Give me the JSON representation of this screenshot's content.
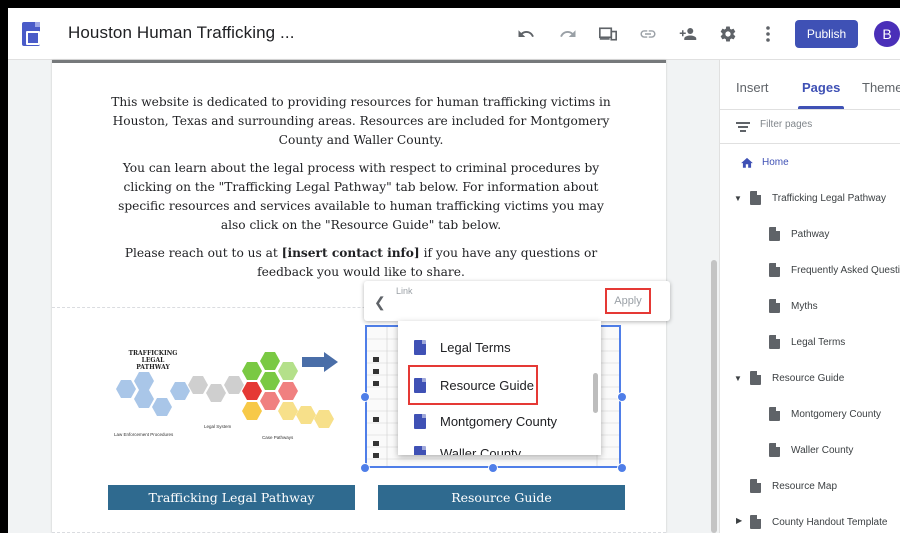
{
  "topbar": {
    "doc_title": "Houston Human Trafficking ...",
    "publish_label": "Publish",
    "avatar_letter": "B",
    "icons": [
      "undo-icon",
      "redo-icon",
      "preview-icon",
      "link-icon",
      "share-icon",
      "settings-icon",
      "more-vert-icon"
    ]
  },
  "intro": {
    "p1": "This website is dedicated to providing resources for human trafficking victims in Houston, Texas and surrounding areas. Resources are included for Montgomery County and Waller County.",
    "p2": "You can learn about the legal process with respect to criminal procedures by clicking on the \"Trafficking Legal Pathway\" tab below. For information about specific resources and services available to human trafficking victims you may also click on the \"Resource Guide\" tab below.",
    "p3_before": "Please reach out to us at ",
    "p3_bold": "[insert contact info]",
    "p3_after": " if you have any questions or feedback you would like to share."
  },
  "diagram": {
    "title": "Trafficking Legal Pathway",
    "caption_left": "Law Enforcement Procedures",
    "caption_mid": "Legal System",
    "caption_right": "Case Pathways"
  },
  "buttons": {
    "legal_pathway": "Trafficking Legal Pathway",
    "resource_guide": "Resource Guide"
  },
  "link_popup": {
    "label": "Link",
    "apply": "Apply",
    "items": [
      "Legal Terms",
      "Resource Guide",
      "Montgomery County",
      "Waller County"
    ]
  },
  "panel": {
    "tabs": [
      "Insert",
      "Pages",
      "Themes"
    ],
    "active_tab": "Pages",
    "filter_placeholder": "Filter pages",
    "pages": [
      {
        "label": "Home",
        "level": 0,
        "home": true
      },
      {
        "label": "Trafficking Legal Pathway",
        "level": 0,
        "expanded": true
      },
      {
        "label": "Pathway",
        "level": 1
      },
      {
        "label": "Frequently Asked Questi...",
        "level": 1
      },
      {
        "label": "Myths",
        "level": 1
      },
      {
        "label": "Legal Terms",
        "level": 1
      },
      {
        "label": "Resource Guide",
        "level": 0,
        "expanded": true
      },
      {
        "label": "Montgomery County",
        "level": 1
      },
      {
        "label": "Waller County",
        "level": 1
      },
      {
        "label": "Resource Map",
        "level": 0
      },
      {
        "label": "County Handout Template",
        "level": 0,
        "collapsed": true
      }
    ]
  },
  "colors": {
    "accent": "#3f51b5",
    "sheet_button": "#2f6a8f",
    "highlight_box": "#e53935",
    "selection": "#4f7ee8"
  }
}
